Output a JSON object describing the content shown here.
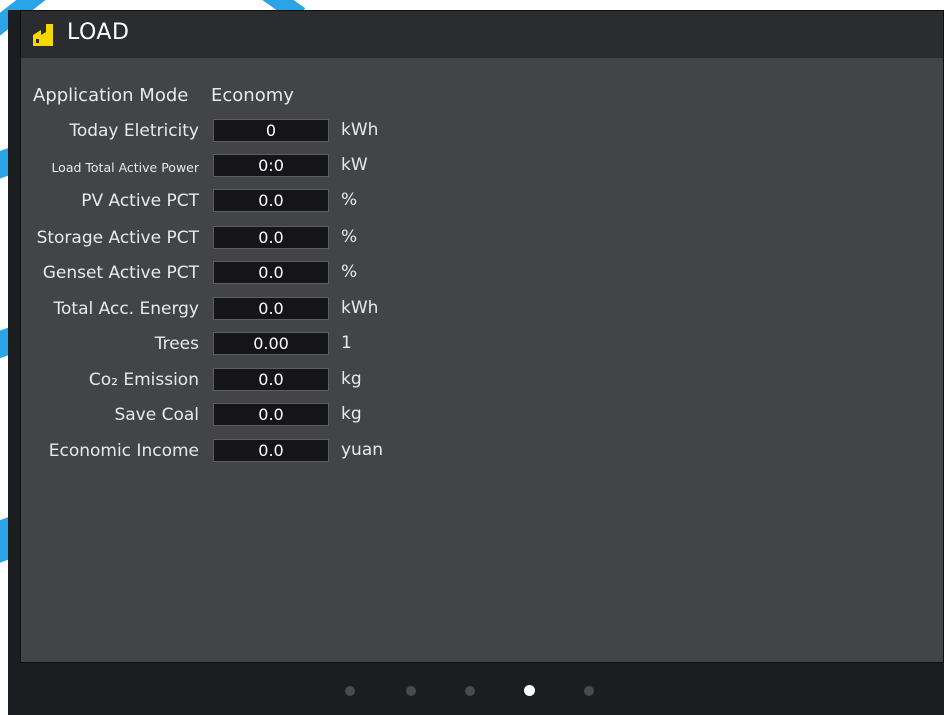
{
  "header": {
    "title": "LOAD",
    "icon": "factory-icon"
  },
  "app_mode": {
    "label": "Application Mode",
    "value": "Economy"
  },
  "rows": [
    {
      "label": "Today Eletricity",
      "value": "0",
      "unit": "kWh"
    },
    {
      "label": "Load Total Active Power",
      "value": "0:0",
      "unit": "kW"
    },
    {
      "label": "PV Active PCT",
      "value": "0.0",
      "unit": "%"
    },
    {
      "label": "Storage Active PCT",
      "value": "0.0",
      "unit": "%"
    },
    {
      "label": "Genset Active PCT",
      "value": "0.0",
      "unit": "%"
    },
    {
      "label": "Total Acc. Energy",
      "value": "0.0",
      "unit": "kWh"
    },
    {
      "label": "Trees",
      "value": "0.00",
      "unit": "1"
    },
    {
      "label": "Co₂ Emission",
      "value": "0.0",
      "unit": "kg"
    },
    {
      "label": "Save Coal",
      "value": "0.0",
      "unit": "kg"
    },
    {
      "label": "Economic Income",
      "value": "0.0",
      "unit": "yuan"
    }
  ],
  "pagination": {
    "total": 5,
    "active_index": 3
  },
  "colors": {
    "accent": "#f5d800",
    "panel": "#434448",
    "header": "#2b2c2f",
    "frame": "#1c1d20"
  }
}
